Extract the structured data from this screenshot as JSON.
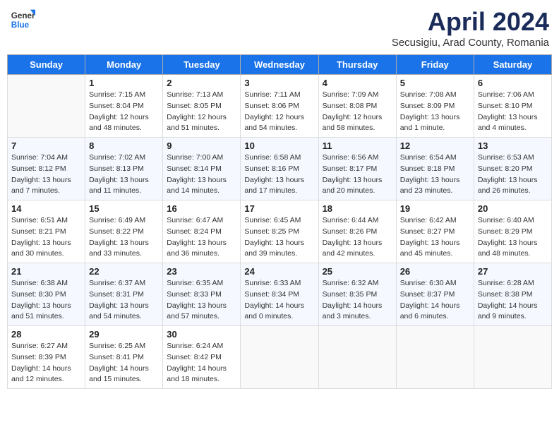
{
  "header": {
    "logo_general": "General",
    "logo_blue": "Blue",
    "title": "April 2024",
    "subtitle": "Secusigiu, Arad County, Romania"
  },
  "days_of_week": [
    "Sunday",
    "Monday",
    "Tuesday",
    "Wednesday",
    "Thursday",
    "Friday",
    "Saturday"
  ],
  "weeks": [
    [
      {
        "day": "",
        "info": ""
      },
      {
        "day": "1",
        "info": "Sunrise: 7:15 AM\nSunset: 8:04 PM\nDaylight: 12 hours and 48 minutes."
      },
      {
        "day": "2",
        "info": "Sunrise: 7:13 AM\nSunset: 8:05 PM\nDaylight: 12 hours and 51 minutes."
      },
      {
        "day": "3",
        "info": "Sunrise: 7:11 AM\nSunset: 8:06 PM\nDaylight: 12 hours and 54 minutes."
      },
      {
        "day": "4",
        "info": "Sunrise: 7:09 AM\nSunset: 8:08 PM\nDaylight: 12 hours and 58 minutes."
      },
      {
        "day": "5",
        "info": "Sunrise: 7:08 AM\nSunset: 8:09 PM\nDaylight: 13 hours and 1 minute."
      },
      {
        "day": "6",
        "info": "Sunrise: 7:06 AM\nSunset: 8:10 PM\nDaylight: 13 hours and 4 minutes."
      }
    ],
    [
      {
        "day": "7",
        "info": "Sunrise: 7:04 AM\nSunset: 8:12 PM\nDaylight: 13 hours and 7 minutes."
      },
      {
        "day": "8",
        "info": "Sunrise: 7:02 AM\nSunset: 8:13 PM\nDaylight: 13 hours and 11 minutes."
      },
      {
        "day": "9",
        "info": "Sunrise: 7:00 AM\nSunset: 8:14 PM\nDaylight: 13 hours and 14 minutes."
      },
      {
        "day": "10",
        "info": "Sunrise: 6:58 AM\nSunset: 8:16 PM\nDaylight: 13 hours and 17 minutes."
      },
      {
        "day": "11",
        "info": "Sunrise: 6:56 AM\nSunset: 8:17 PM\nDaylight: 13 hours and 20 minutes."
      },
      {
        "day": "12",
        "info": "Sunrise: 6:54 AM\nSunset: 8:18 PM\nDaylight: 13 hours and 23 minutes."
      },
      {
        "day": "13",
        "info": "Sunrise: 6:53 AM\nSunset: 8:20 PM\nDaylight: 13 hours and 26 minutes."
      }
    ],
    [
      {
        "day": "14",
        "info": "Sunrise: 6:51 AM\nSunset: 8:21 PM\nDaylight: 13 hours and 30 minutes."
      },
      {
        "day": "15",
        "info": "Sunrise: 6:49 AM\nSunset: 8:22 PM\nDaylight: 13 hours and 33 minutes."
      },
      {
        "day": "16",
        "info": "Sunrise: 6:47 AM\nSunset: 8:24 PM\nDaylight: 13 hours and 36 minutes."
      },
      {
        "day": "17",
        "info": "Sunrise: 6:45 AM\nSunset: 8:25 PM\nDaylight: 13 hours and 39 minutes."
      },
      {
        "day": "18",
        "info": "Sunrise: 6:44 AM\nSunset: 8:26 PM\nDaylight: 13 hours and 42 minutes."
      },
      {
        "day": "19",
        "info": "Sunrise: 6:42 AM\nSunset: 8:27 PM\nDaylight: 13 hours and 45 minutes."
      },
      {
        "day": "20",
        "info": "Sunrise: 6:40 AM\nSunset: 8:29 PM\nDaylight: 13 hours and 48 minutes."
      }
    ],
    [
      {
        "day": "21",
        "info": "Sunrise: 6:38 AM\nSunset: 8:30 PM\nDaylight: 13 hours and 51 minutes."
      },
      {
        "day": "22",
        "info": "Sunrise: 6:37 AM\nSunset: 8:31 PM\nDaylight: 13 hours and 54 minutes."
      },
      {
        "day": "23",
        "info": "Sunrise: 6:35 AM\nSunset: 8:33 PM\nDaylight: 13 hours and 57 minutes."
      },
      {
        "day": "24",
        "info": "Sunrise: 6:33 AM\nSunset: 8:34 PM\nDaylight: 14 hours and 0 minutes."
      },
      {
        "day": "25",
        "info": "Sunrise: 6:32 AM\nSunset: 8:35 PM\nDaylight: 14 hours and 3 minutes."
      },
      {
        "day": "26",
        "info": "Sunrise: 6:30 AM\nSunset: 8:37 PM\nDaylight: 14 hours and 6 minutes."
      },
      {
        "day": "27",
        "info": "Sunrise: 6:28 AM\nSunset: 8:38 PM\nDaylight: 14 hours and 9 minutes."
      }
    ],
    [
      {
        "day": "28",
        "info": "Sunrise: 6:27 AM\nSunset: 8:39 PM\nDaylight: 14 hours and 12 minutes."
      },
      {
        "day": "29",
        "info": "Sunrise: 6:25 AM\nSunset: 8:41 PM\nDaylight: 14 hours and 15 minutes."
      },
      {
        "day": "30",
        "info": "Sunrise: 6:24 AM\nSunset: 8:42 PM\nDaylight: 14 hours and 18 minutes."
      },
      {
        "day": "",
        "info": ""
      },
      {
        "day": "",
        "info": ""
      },
      {
        "day": "",
        "info": ""
      },
      {
        "day": "",
        "info": ""
      }
    ]
  ]
}
